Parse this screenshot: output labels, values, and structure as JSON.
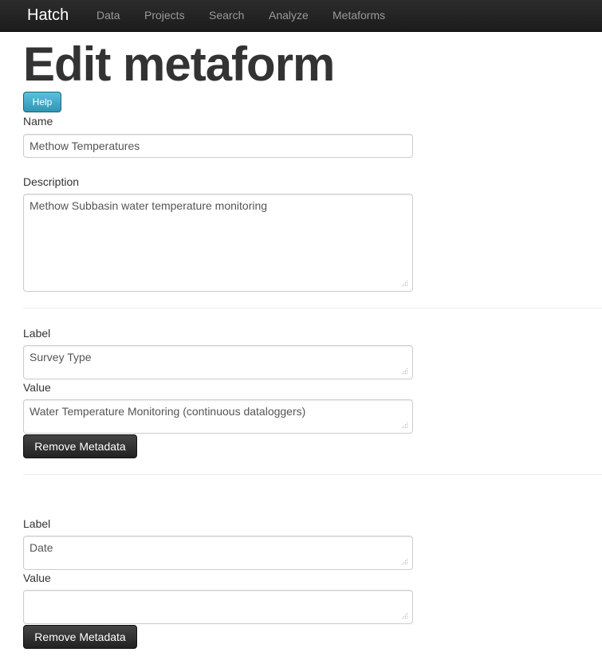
{
  "nav": {
    "brand": "Hatch",
    "items": [
      "Data",
      "Projects",
      "Search",
      "Analyze",
      "Metaforms"
    ]
  },
  "page": {
    "title": "Edit metaform",
    "help_label": "Help"
  },
  "form": {
    "name_label": "Name",
    "name_value": "Methow Temperatures",
    "description_label": "Description",
    "description_value": "Methow Subbasin water temperature monitoring"
  },
  "metadata": [
    {
      "label_label": "Label",
      "label_value": "Survey Type",
      "value_label": "Value",
      "value_value": "Water Temperature Monitoring (continuous dataloggers)",
      "remove_label": "Remove Metadata"
    },
    {
      "label_label": "Label",
      "label_value": "Date",
      "value_label": "Value",
      "value_value": "",
      "remove_label": "Remove Metadata"
    }
  ],
  "colors": {
    "navbar": "#1c1c1c",
    "help_button": "#2f96b4",
    "remove_button": "#222222"
  }
}
